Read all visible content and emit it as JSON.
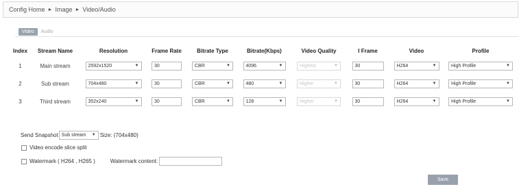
{
  "breadcrumb": {
    "items": [
      "Config Home",
      "Image",
      "Video/Audio"
    ]
  },
  "tabs": [
    {
      "label": "Video",
      "active": true
    },
    {
      "label": "Audio",
      "active": false
    }
  ],
  "table": {
    "headers": [
      "Index",
      "Stream Name",
      "Resolution",
      "Frame Rate",
      "Bitrate Type",
      "Bitrate(Kbps)",
      "Video Quality",
      "I Frame",
      "Video",
      "Profile"
    ],
    "rows": [
      {
        "index": "1",
        "name": "Main stream",
        "resolution": "2592x1520",
        "frame_rate": "30",
        "bitrate_type": "CBR",
        "bitrate": "4096",
        "quality": "Highest",
        "iframe": "30",
        "video": "H264",
        "profile": "High Profile"
      },
      {
        "index": "2",
        "name": "Sub stream",
        "resolution": "704x480",
        "frame_rate": "30",
        "bitrate_type": "CBR",
        "bitrate": "480",
        "quality": "Higher",
        "iframe": "30",
        "video": "H264",
        "profile": "High Profile"
      },
      {
        "index": "3",
        "name": "Third stream",
        "resolution": "352x240",
        "frame_rate": "30",
        "bitrate_type": "CBR",
        "bitrate": "128",
        "quality": "Higher",
        "iframe": "30",
        "video": "H264",
        "profile": "High Profile"
      }
    ]
  },
  "snapshot": {
    "label": "Send Snapshot",
    "value": "Sub stream",
    "size_text": "Size: (704x480)"
  },
  "options": {
    "slice_split": {
      "label": "Video encode slice split",
      "checked": false
    },
    "watermark": {
      "label": "Watermark ( H264 , H265 )",
      "checked": false,
      "content_label": "Watermark content:",
      "content_value": ""
    }
  },
  "save_label": "Save"
}
